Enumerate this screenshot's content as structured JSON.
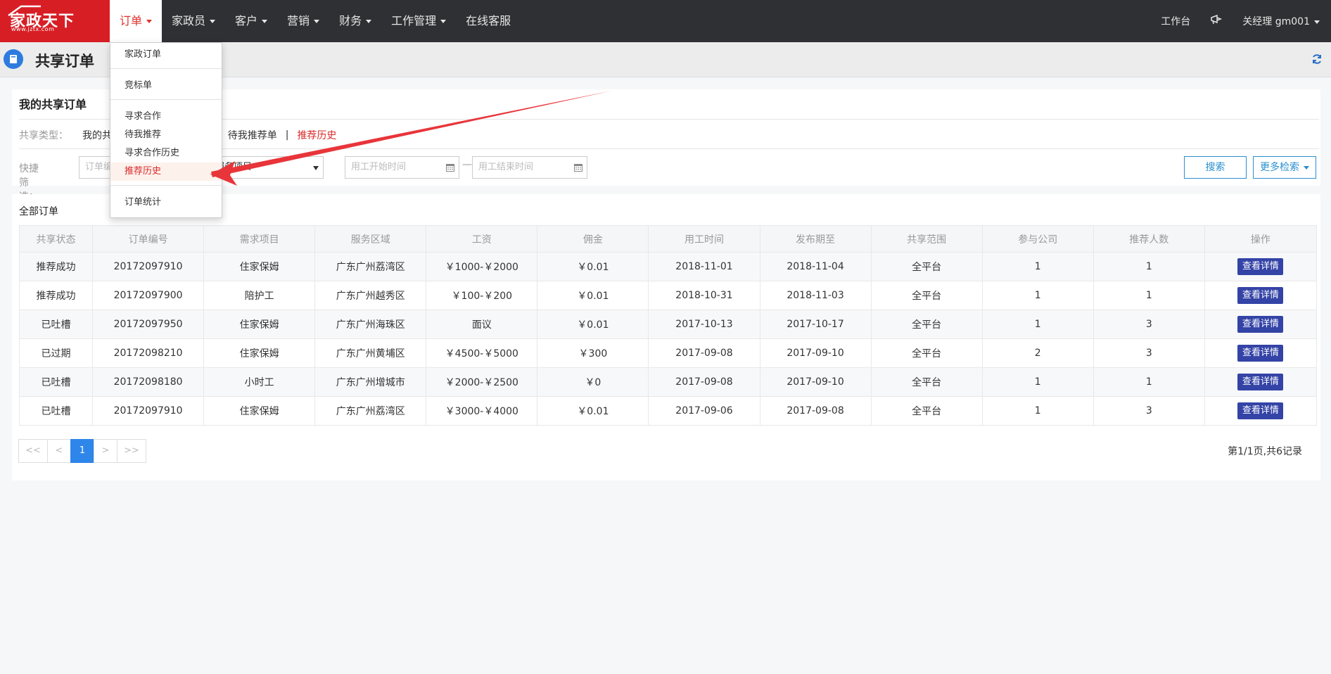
{
  "logo": {
    "text": "家政天下",
    "url": "www.jztx.com"
  },
  "nav": {
    "items": [
      {
        "label": "订单",
        "dropdown": true,
        "active": true
      },
      {
        "label": "家政员",
        "dropdown": true
      },
      {
        "label": "客户",
        "dropdown": true
      },
      {
        "label": "营销",
        "dropdown": true
      },
      {
        "label": "财务",
        "dropdown": true
      },
      {
        "label": "工作管理",
        "dropdown": true
      },
      {
        "label": "在线客服",
        "dropdown": false
      }
    ],
    "workbench": "工作台",
    "user": "关经理  gm001"
  },
  "page": {
    "title": "共享订单"
  },
  "filter_panel": {
    "title": "我的共享订单",
    "type_label": "共享类型：",
    "types": [
      "我的共",
      "待我推荐单",
      "推荐历史"
    ],
    "quick_label": "快捷筛选：",
    "order_no_placeholder": "订单编",
    "service_item_value": "服务项目",
    "start_time_placeholder": "用工开始时间",
    "end_time_placeholder": "用工结束时间",
    "dash": "—",
    "search_label": "搜索",
    "more_label": "更多检索"
  },
  "table": {
    "section_title": "全部订单",
    "columns": [
      "共享状态",
      "订单编号",
      "需求项目",
      "服务区域",
      "工资",
      "佣金",
      "用工时间",
      "发布期至",
      "共享范围",
      "参与公司",
      "推荐人数",
      "操作"
    ],
    "action_label": "查看详情",
    "rows": [
      {
        "status": "推荐成功",
        "status_type": "ok",
        "order_no": "20172097910",
        "item": "住家保姆",
        "area": "广东广州荔湾区",
        "salary": "￥1000-￥2000",
        "commission": "￥0.01",
        "work_time": "2018-11-01",
        "publish_until": "2018-11-04",
        "scope": "全平台",
        "companies": "1",
        "recommenders": "1"
      },
      {
        "status": "推荐成功",
        "status_type": "ok",
        "order_no": "20172097900",
        "item": "陪护工",
        "area": "广东广州越秀区",
        "salary": "￥100-￥200",
        "commission": "￥0.01",
        "work_time": "2018-10-31",
        "publish_until": "2018-11-03",
        "scope": "全平台",
        "companies": "1",
        "recommenders": "1"
      },
      {
        "status": "已吐槽",
        "status_type": "ok",
        "order_no": "20172097950",
        "item": "住家保姆",
        "area": "广东广州海珠区",
        "salary": "面议",
        "commission": "￥0.01",
        "work_time": "2017-10-13",
        "publish_until": "2017-10-17",
        "scope": "全平台",
        "companies": "1",
        "recommenders": "3"
      },
      {
        "status": "已过期",
        "status_type": "gray",
        "order_no": "20172098210",
        "item": "住家保姆",
        "area": "广东广州黄埔区",
        "salary": "￥4500-￥5000",
        "commission": "￥300",
        "work_time": "2017-09-08",
        "publish_until": "2017-09-10",
        "scope": "全平台",
        "companies": "2",
        "recommenders": "3"
      },
      {
        "status": "已吐槽",
        "status_type": "ok",
        "order_no": "20172098180",
        "item": "小时工",
        "area": "广东广州增城市",
        "salary": "￥2000-￥2500",
        "commission": "￥0",
        "work_time": "2017-09-08",
        "publish_until": "2017-09-10",
        "scope": "全平台",
        "companies": "1",
        "recommenders": "1"
      },
      {
        "status": "已吐槽",
        "status_type": "ok",
        "order_no": "20172097910",
        "item": "住家保姆",
        "area": "广东广州荔湾区",
        "salary": "￥3000-￥4000",
        "commission": "￥0.01",
        "work_time": "2017-09-06",
        "publish_until": "2017-09-08",
        "scope": "全平台",
        "companies": "1",
        "recommenders": "3"
      }
    ]
  },
  "pagination": {
    "first": "<<",
    "prev": "<",
    "current": "1",
    "next": ">",
    "last": ">>",
    "info": "第1/1页,共6记录"
  },
  "dropdown_menu": {
    "groups": [
      [
        "家政订单"
      ],
      [
        "竞标单"
      ],
      [
        "寻求合作",
        "待我推荐",
        "寻求合作历史",
        "推荐历史"
      ],
      [
        "订单统计"
      ]
    ],
    "active": "推荐历史"
  },
  "colors": {
    "navbar": "#2f3033",
    "brand_red": "#d81e25",
    "status_green": "#18a36c",
    "detail_button": "#3343a6",
    "link_blue": "#2a8fcf",
    "annotation_arrow": "#e8353a"
  }
}
